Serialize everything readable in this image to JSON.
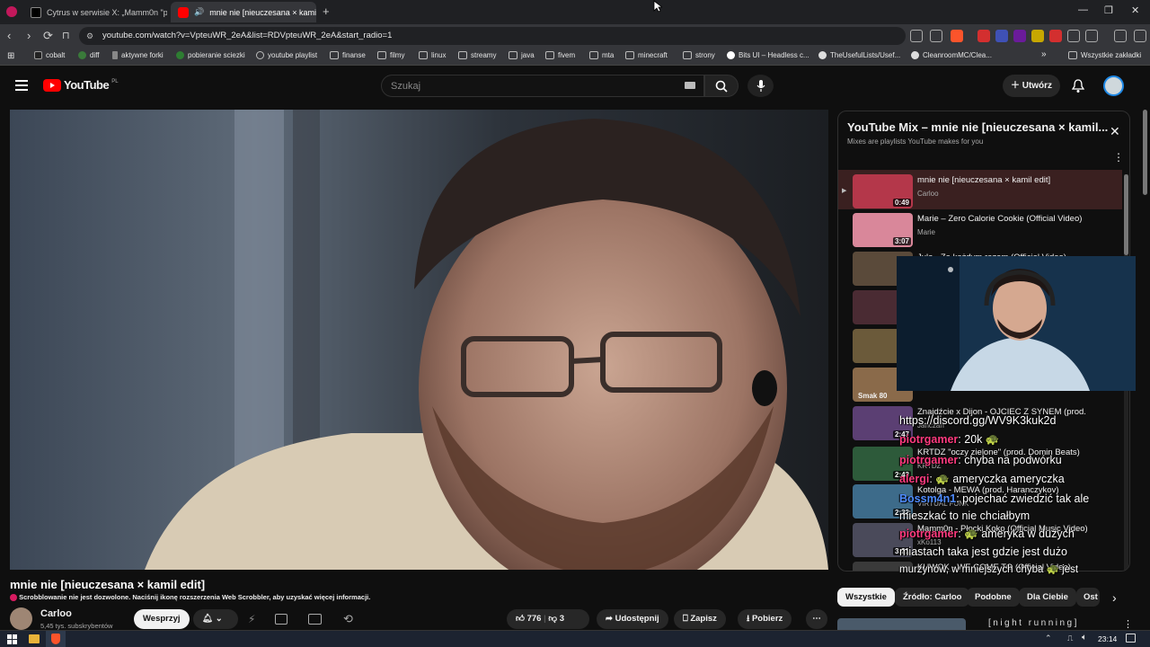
{
  "browser": {
    "tabs": [
      {
        "title": "Cytrus w serwisie X: „Mamm0n \"płac...",
        "active": false
      },
      {
        "title": "mnie nie [nieuczesana × kami...",
        "active": true
      }
    ],
    "new_tab": "+",
    "url": "youtube.com/watch?v=VpteuWR_2eA&list=RDVpteuWR_2eA&start_radio=1",
    "bookmarks": [
      "cobalt",
      "diff",
      "aktywne forki",
      "pobieranie sciezki",
      "youtube playlist",
      "finanse",
      "filmy",
      "linux",
      "streamy",
      "java",
      "fivem",
      "mta",
      "minecraft",
      "strony",
      "Bits UI – Headless c...",
      "TheUsefulLists/Usef...",
      "CleanroomMC/Clea..."
    ],
    "bookmarks_overflow": "»",
    "all_bookmarks": "Wszystkie zakładki"
  },
  "youtube": {
    "logo": "YouTube",
    "region": "PL",
    "search_placeholder": "Szukaj",
    "create_label": "Utwórz"
  },
  "playlist": {
    "title": "YouTube Mix – mnie nie [nieuczesana × kamil...",
    "subtitle": "Mixes are playlists YouTube makes for you",
    "items": [
      {
        "title": "mnie nie [nieuczesana × kamil edit]",
        "channel": "Carloo",
        "duration": "0:49",
        "thumb": "#b4374a",
        "playing": true
      },
      {
        "title": "Marie – Zero Calorie Cookie (Official Video)",
        "channel": "Marie",
        "duration": "3:07",
        "thumb": "#d9879a"
      },
      {
        "title": "Jula - Za każdym razem (Official Video)",
        "channel": "",
        "duration": "",
        "thumb": "#5a4a3a"
      },
      {
        "title": "",
        "channel": "",
        "duration": "",
        "thumb": "#4a2b33"
      },
      {
        "title": "",
        "channel": "",
        "duration": "",
        "thumb": "#6b5a3a"
      },
      {
        "title": "",
        "channel": "",
        "duration": "",
        "thumb": "#8a6a4a",
        "label": "Smak 80"
      },
      {
        "title": "Znajdźcie x Dijon - OJCIEC Z SYNEM (prod.",
        "channel": "Janczan",
        "duration": "2:47",
        "thumb": "#5b3f73"
      },
      {
        "title": "KRTDZ \"oczy zielone\" (prod. Domin Beats)",
        "channel": "KRTDZ",
        "duration": "2:43",
        "thumb": "#2d5a3a"
      },
      {
        "title": "Kotolga - MEWA (prod. Haranczykov)",
        "channel": "VIRTUAL FUNK",
        "duration": "2:32",
        "thumb": "#3d6b8a"
      },
      {
        "title": "Mamm0n - Płocki Koko (Official Music Video)",
        "channel": "xKo113",
        "duration": "3:21",
        "thumb": "#4a4a5a"
      },
      {
        "title": "KUWOK - WE COME TO (Official Video)",
        "channel": "",
        "duration": "",
        "thumb": "#3a3a3a"
      }
    ]
  },
  "chat": [
    {
      "nick": "",
      "text": "https://discord.gg/WV9K3kuk2d"
    },
    {
      "nick": "piotrgamer",
      "text": ": 20k 🐢"
    },
    {
      "nick": "piotrgamer",
      "text": ": chyba na podwórku"
    },
    {
      "nick": "alergi",
      "text": ": 🐢 ameryczka ameryczka"
    },
    {
      "nick": "Bossm4n1",
      "text": ": pojechać zwiedzić tak ale"
    },
    {
      "nick": "",
      "text": "mieszkać to nie chciałbym"
    },
    {
      "nick": "piotrgamer",
      "text": ": 🐢 ameryka w dużych"
    },
    {
      "nick": "",
      "text": "miastach taka jest gdzie jest dużo"
    },
    {
      "nick": "",
      "text": "murzynów, w mniejszych chyba 🐢 jest"
    }
  ],
  "video": {
    "title": "mnie nie [nieuczesana × kamil edit]",
    "scrobbler_warning": "Scrobblowanie nie jest dozwolone. Naciśnij ikonę rozszerzenia Web Scrobbler, aby uzyskać więcej informacji.",
    "channel": "Carloo",
    "subscribers": "5,45 tys. subskrybentów",
    "support_label": "Wesprzyj",
    "likes": "776",
    "dislikes": "3",
    "share_label": "Udostępnij",
    "save_label": "Zapisz",
    "download_label": "Pobierz"
  },
  "chips": [
    "Wszystkie",
    "Źródło: Carloo",
    "Podobne",
    "Dla Ciebie",
    "Ost"
  ],
  "next_video_title": "[night running]",
  "clock": "23:14",
  "colors": {
    "youtube_red": "#ff0000",
    "accent_red": "#ff3b7f",
    "playlist_active_bg": "#3a2020"
  }
}
